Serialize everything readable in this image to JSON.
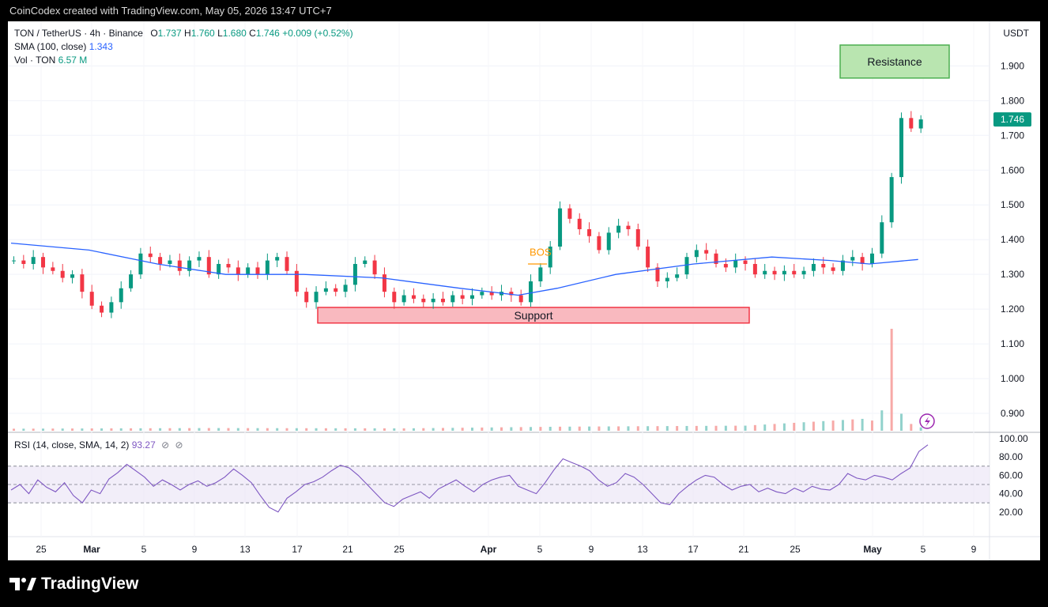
{
  "credit": "CoinCodex created with TradingView.com, May 05, 2026 13:47 UTC+7",
  "legend": {
    "symbol": "TON / TetherUS · 4h · Binance",
    "o_label": "O",
    "o": "1.737",
    "h_label": "H",
    "h": "1.760",
    "l_label": "L",
    "l": "1.680",
    "c_label": "C",
    "c": "1.746",
    "change": "+0.009 (+0.52%)",
    "sma_label": "SMA (100, close)",
    "sma_value": "1.343",
    "vol_label": "Vol · TON",
    "vol_value": "6.57 M",
    "rsi_label": "RSI (14, close, SMA, 14, 2)",
    "rsi_value": "93.27"
  },
  "currency": "USDT",
  "footer": "TradingView",
  "colors": {
    "up": "#089981",
    "down": "#f23645",
    "sma": "#2962ff",
    "rsi": "#7e57c2",
    "support_fill": "#f9b9bf",
    "support_border": "#f23645",
    "resistance_fill": "#b9e5b0",
    "resistance_border": "#4caf50",
    "bos": "#ff9800"
  },
  "chart_data": {
    "type": "candlestick",
    "title": "TON / TetherUS · 4h · Binance",
    "y_ticks": [
      "1.900",
      "1.800",
      "1.700",
      "1.600",
      "1.500",
      "1.400",
      "1.300",
      "1.200",
      "1.100",
      "1.000",
      "0.900"
    ],
    "ylim": [
      0.85,
      1.96
    ],
    "x_ticks": [
      "25",
      "Mar",
      "5",
      "9",
      "13",
      "17",
      "21",
      "25",
      "Apr",
      "5",
      "9",
      "13",
      "17",
      "21",
      "25",
      "May",
      "5",
      "9"
    ],
    "last_price": "1.746",
    "annotations": {
      "resistance": "Resistance",
      "support": "Support",
      "bos": "BOS",
      "support_range": [
        1.16,
        1.205
      ],
      "resistance_range": [
        1.865,
        1.96
      ]
    },
    "rsi": {
      "ticks": [
        "100.00",
        "80.00",
        "60.00",
        "40.00",
        "20.00"
      ],
      "band": [
        30,
        70
      ],
      "last": 93.27,
      "path": [
        [
          0,
          44
        ],
        [
          1,
          50
        ],
        [
          2,
          40
        ],
        [
          3,
          55
        ],
        [
          4,
          47
        ],
        [
          5,
          42
        ],
        [
          6,
          52
        ],
        [
          7,
          38
        ],
        [
          8,
          30
        ],
        [
          9,
          44
        ],
        [
          10,
          40
        ],
        [
          11,
          56
        ],
        [
          12,
          63
        ],
        [
          13,
          72
        ],
        [
          14,
          65
        ],
        [
          15,
          58
        ],
        [
          16,
          48
        ],
        [
          17,
          55
        ],
        [
          18,
          50
        ],
        [
          19,
          44
        ],
        [
          20,
          50
        ],
        [
          21,
          54
        ],
        [
          22,
          48
        ],
        [
          23,
          52
        ],
        [
          24,
          58
        ],
        [
          25,
          67
        ],
        [
          26,
          60
        ],
        [
          27,
          52
        ],
        [
          28,
          38
        ],
        [
          29,
          25
        ],
        [
          30,
          20
        ],
        [
          31,
          35
        ],
        [
          32,
          42
        ],
        [
          33,
          50
        ],
        [
          34,
          53
        ],
        [
          35,
          58
        ],
        [
          36,
          65
        ],
        [
          37,
          71
        ],
        [
          38,
          68
        ],
        [
          39,
          60
        ],
        [
          40,
          50
        ],
        [
          41,
          40
        ],
        [
          42,
          30
        ],
        [
          43,
          26
        ],
        [
          44,
          34
        ],
        [
          45,
          38
        ],
        [
          46,
          42
        ],
        [
          47,
          35
        ],
        [
          48,
          45
        ],
        [
          49,
          50
        ],
        [
          50,
          55
        ],
        [
          51,
          48
        ],
        [
          52,
          42
        ],
        [
          53,
          50
        ],
        [
          54,
          55
        ],
        [
          55,
          58
        ],
        [
          56,
          60
        ],
        [
          57,
          48
        ],
        [
          58,
          44
        ],
        [
          59,
          40
        ],
        [
          60,
          52
        ],
        [
          61,
          66
        ],
        [
          62,
          78
        ],
        [
          63,
          74
        ],
        [
          64,
          70
        ],
        [
          65,
          65
        ],
        [
          66,
          55
        ],
        [
          67,
          48
        ],
        [
          68,
          52
        ],
        [
          69,
          62
        ],
        [
          70,
          58
        ],
        [
          71,
          50
        ],
        [
          72,
          40
        ],
        [
          73,
          30
        ],
        [
          74,
          28
        ],
        [
          75,
          40
        ],
        [
          76,
          48
        ],
        [
          77,
          55
        ],
        [
          78,
          60
        ],
        [
          79,
          58
        ],
        [
          80,
          50
        ],
        [
          81,
          44
        ],
        [
          82,
          48
        ],
        [
          83,
          50
        ],
        [
          84,
          42
        ],
        [
          85,
          46
        ],
        [
          86,
          42
        ],
        [
          87,
          40
        ],
        [
          88,
          46
        ],
        [
          89,
          42
        ],
        [
          90,
          48
        ],
        [
          91,
          45
        ],
        [
          92,
          44
        ],
        [
          93,
          50
        ],
        [
          94,
          62
        ],
        [
          95,
          57
        ],
        [
          96,
          55
        ],
        [
          97,
          60
        ],
        [
          98,
          58
        ],
        [
          99,
          55
        ],
        [
          100,
          62
        ],
        [
          101,
          68
        ],
        [
          102,
          86
        ],
        [
          103,
          93.27
        ]
      ]
    },
    "ohlc_path": [
      [
        0,
        1.34
      ],
      [
        1,
        1.33
      ],
      [
        2,
        1.35
      ],
      [
        3,
        1.32
      ],
      [
        4,
        1.31
      ],
      [
        5,
        1.29
      ],
      [
        6,
        1.3
      ],
      [
        7,
        1.25
      ],
      [
        8,
        1.21
      ],
      [
        9,
        1.19
      ],
      [
        10,
        1.22
      ],
      [
        11,
        1.26
      ],
      [
        12,
        1.3
      ],
      [
        13,
        1.36
      ],
      [
        14,
        1.35
      ],
      [
        15,
        1.33
      ],
      [
        16,
        1.34
      ],
      [
        17,
        1.31
      ],
      [
        18,
        1.34
      ],
      [
        19,
        1.35
      ],
      [
        20,
        1.3
      ],
      [
        21,
        1.33
      ],
      [
        22,
        1.32
      ],
      [
        23,
        1.3
      ],
      [
        24,
        1.32
      ],
      [
        25,
        1.3
      ],
      [
        26,
        1.34
      ],
      [
        27,
        1.35
      ],
      [
        28,
        1.31
      ],
      [
        29,
        1.25
      ],
      [
        30,
        1.22
      ],
      [
        31,
        1.25
      ],
      [
        32,
        1.26
      ],
      [
        33,
        1.25
      ],
      [
        34,
        1.27
      ],
      [
        35,
        1.33
      ],
      [
        36,
        1.34
      ],
      [
        37,
        1.3
      ],
      [
        38,
        1.25
      ],
      [
        39,
        1.22
      ],
      [
        40,
        1.24
      ],
      [
        41,
        1.23
      ],
      [
        42,
        1.22
      ],
      [
        43,
        1.23
      ],
      [
        44,
        1.22
      ],
      [
        45,
        1.24
      ],
      [
        46,
        1.23
      ],
      [
        47,
        1.24
      ],
      [
        48,
        1.25
      ],
      [
        49,
        1.24
      ],
      [
        50,
        1.25
      ],
      [
        51,
        1.24
      ],
      [
        52,
        1.22
      ],
      [
        53,
        1.28
      ],
      [
        54,
        1.32
      ],
      [
        55,
        1.38
      ],
      [
        56,
        1.49
      ],
      [
        57,
        1.46
      ],
      [
        58,
        1.43
      ],
      [
        59,
        1.41
      ],
      [
        60,
        1.37
      ],
      [
        61,
        1.42
      ],
      [
        62,
        1.44
      ],
      [
        63,
        1.43
      ],
      [
        64,
        1.38
      ],
      [
        65,
        1.32
      ],
      [
        66,
        1.28
      ],
      [
        67,
        1.29
      ],
      [
        68,
        1.3
      ],
      [
        69,
        1.35
      ],
      [
        70,
        1.37
      ],
      [
        71,
        1.36
      ],
      [
        72,
        1.33
      ],
      [
        73,
        1.32
      ],
      [
        74,
        1.34
      ],
      [
        75,
        1.33
      ],
      [
        76,
        1.3
      ],
      [
        77,
        1.31
      ],
      [
        78,
        1.3
      ],
      [
        79,
        1.31
      ],
      [
        80,
        1.3
      ],
      [
        81,
        1.31
      ],
      [
        82,
        1.33
      ],
      [
        83,
        1.32
      ],
      [
        84,
        1.31
      ],
      [
        85,
        1.34
      ],
      [
        86,
        1.35
      ],
      [
        87,
        1.33
      ],
      [
        88,
        1.36
      ],
      [
        89,
        1.45
      ],
      [
        90,
        1.58
      ],
      [
        91,
        1.75
      ],
      [
        92,
        1.72
      ],
      [
        93,
        1.746
      ]
    ],
    "sma_path": [
      [
        0,
        1.39
      ],
      [
        8,
        1.37
      ],
      [
        15,
        1.33
      ],
      [
        22,
        1.3
      ],
      [
        30,
        1.3
      ],
      [
        38,
        1.29
      ],
      [
        46,
        1.26
      ],
      [
        52,
        1.24
      ],
      [
        56,
        1.26
      ],
      [
        62,
        1.3
      ],
      [
        70,
        1.33
      ],
      [
        78,
        1.35
      ],
      [
        84,
        1.34
      ],
      [
        88,
        1.33
      ],
      [
        93,
        1.343
      ]
    ],
    "volume_path": [
      [
        0,
        0.006
      ],
      [
        20,
        0.008
      ],
      [
        40,
        0.007
      ],
      [
        56,
        0.012
      ],
      [
        75,
        0.015
      ],
      [
        87,
        0.035
      ],
      [
        88,
        0.03
      ],
      [
        89,
        0.06
      ],
      [
        90,
        0.3
      ],
      [
        91,
        0.05
      ],
      [
        92,
        0.02
      ],
      [
        93,
        0.01
      ]
    ]
  }
}
